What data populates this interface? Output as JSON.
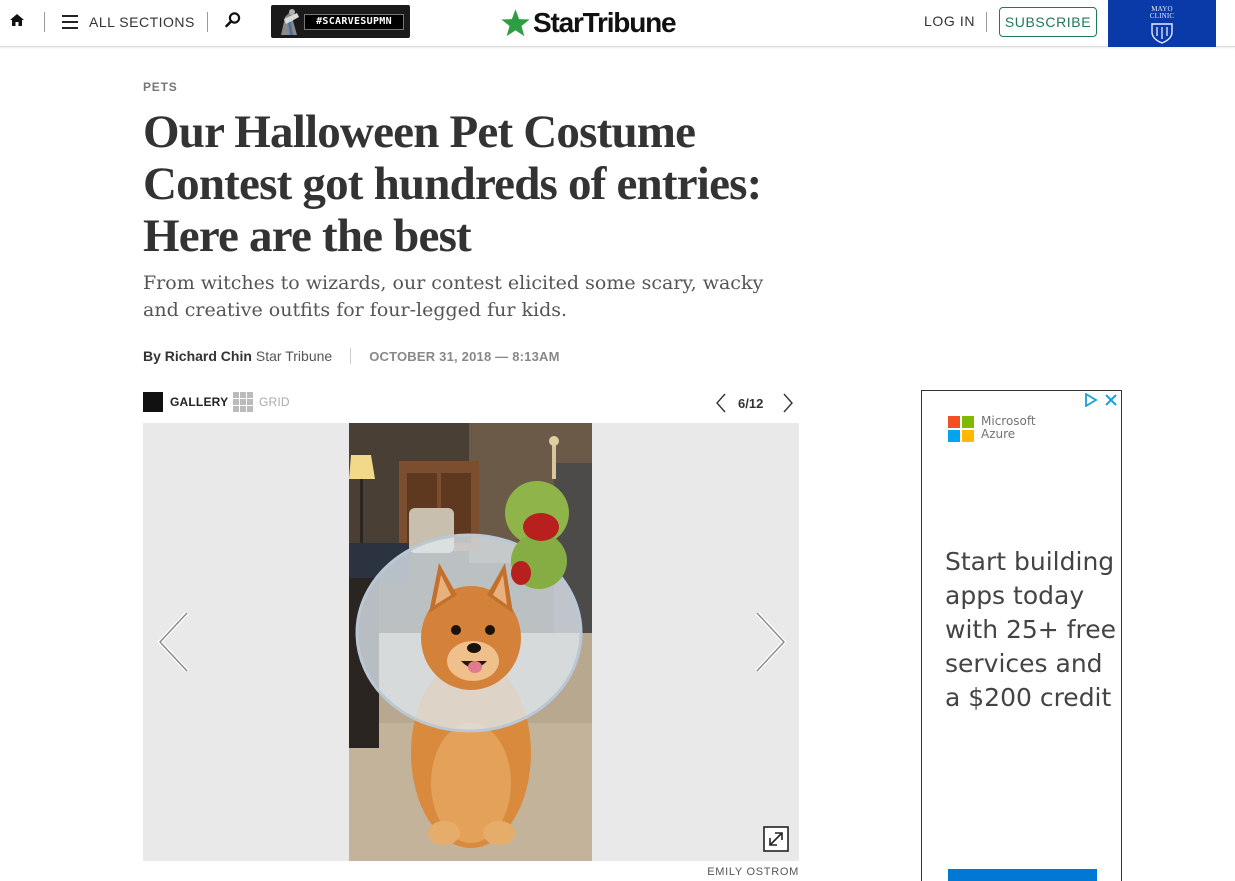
{
  "header": {
    "menu_label": "ALL SECTIONS",
    "promo_tag": "#SCARVESUPMN",
    "brand_name": "StarTribune",
    "login_label": "LOG IN",
    "subscribe_label": "SUBSCRIBE",
    "sponsor_text": "MAYO CLINIC",
    "brand_color": "#1e7a52",
    "sponsor_color": "#0a3aa8"
  },
  "article": {
    "section": "PETS",
    "headline": "Our Halloween Pet Costume Contest got hundreds of entries: Here are the best",
    "dek": "From witches to wizards, our contest elicited some scary, wacky and creative outfits for four-legged fur kids.",
    "byline": {
      "prefix": "By",
      "author": "Richard Chin",
      "outlet": "Star Tribune",
      "date": "OCTOBER 31, 2018 — 8:13AM"
    }
  },
  "gallery": {
    "gallery_label": "GALLERY",
    "grid_label": "GRID",
    "position": "6/12",
    "photo_credit": "EMILY OSTROM"
  },
  "ad": {
    "advertiser": "Microsoft\nAzure",
    "copy": "Start building apps today with 25+ free services and a $200 credit",
    "cta_color": "#0078d4"
  }
}
